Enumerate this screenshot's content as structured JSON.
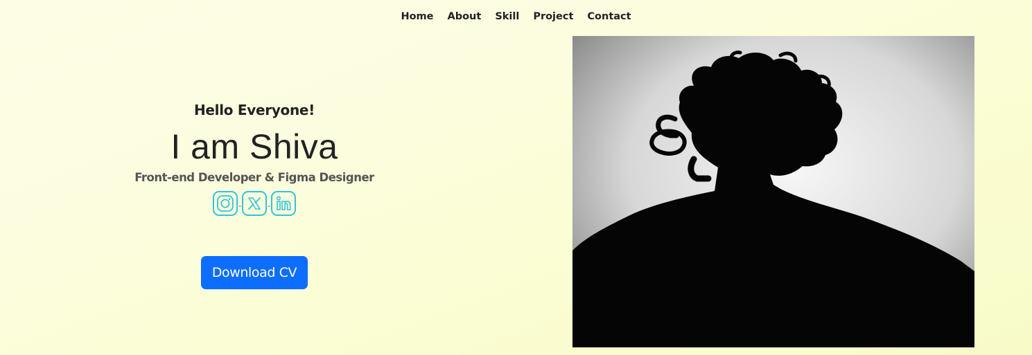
{
  "nav": {
    "items": [
      {
        "label": "Home"
      },
      {
        "label": "About"
      },
      {
        "label": "Skill"
      },
      {
        "label": "Project"
      },
      {
        "label": "Contact"
      }
    ]
  },
  "hero": {
    "greeting": "Hello Everyone!",
    "name": "I am Shiva",
    "role": "Front-end Developer & Figma Designer",
    "social_separator": "-",
    "socials": [
      {
        "icon": "instagram-icon"
      },
      {
        "icon": "x-twitter-icon"
      },
      {
        "icon": "linkedin-icon"
      }
    ],
    "download_label": "Download CV"
  },
  "colors": {
    "accent": "#0d6efd",
    "icon_outline": "#2fc3e0"
  }
}
